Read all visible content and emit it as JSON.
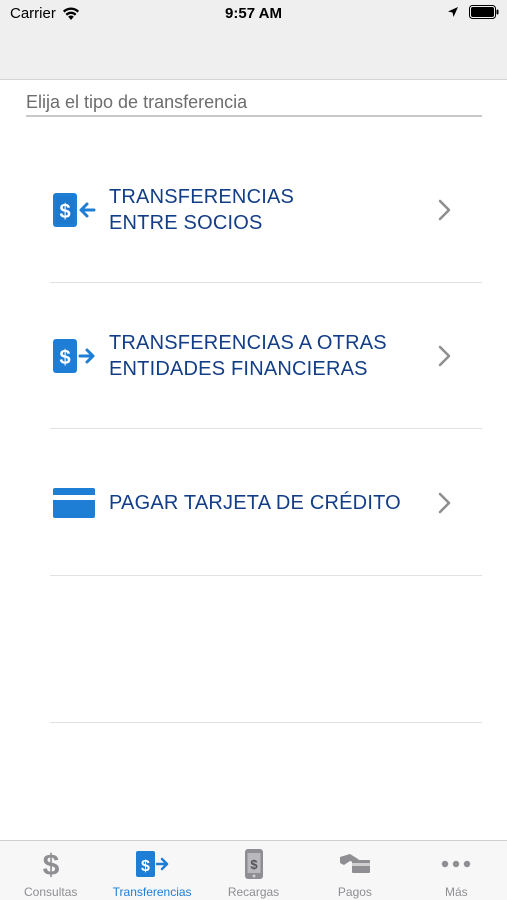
{
  "status_bar": {
    "carrier": "Carrier",
    "time": "9:57 AM"
  },
  "header": {
    "label": "Elija el tipo de transferencia"
  },
  "options": [
    {
      "line1": "TRANSFERENCIAS",
      "line2": "ENTRE SOCIOS",
      "icon": "dollar-transfer-in-icon"
    },
    {
      "line1": "TRANSFERENCIAS A OTRAS",
      "line2": "ENTIDADES FINANCIERAS",
      "icon": "dollar-transfer-out-icon"
    },
    {
      "line1": "PAGAR TARJETA DE CRÉDITO",
      "line2": "",
      "icon": "credit-card-icon"
    }
  ],
  "tabs": [
    {
      "label": "Consultas",
      "icon": "dollar-icon",
      "active": false
    },
    {
      "label": "Transferencias",
      "icon": "transfer-icon",
      "active": true
    },
    {
      "label": "Recargas",
      "icon": "phone-recharge-icon",
      "active": false
    },
    {
      "label": "Pagos",
      "icon": "payment-hand-icon",
      "active": false
    },
    {
      "label": "Más",
      "icon": "more-icon",
      "active": false
    }
  ],
  "colors": {
    "accent": "#1e7ed6",
    "option_text": "#133e87",
    "tab_inactive": "#8e8e93"
  }
}
